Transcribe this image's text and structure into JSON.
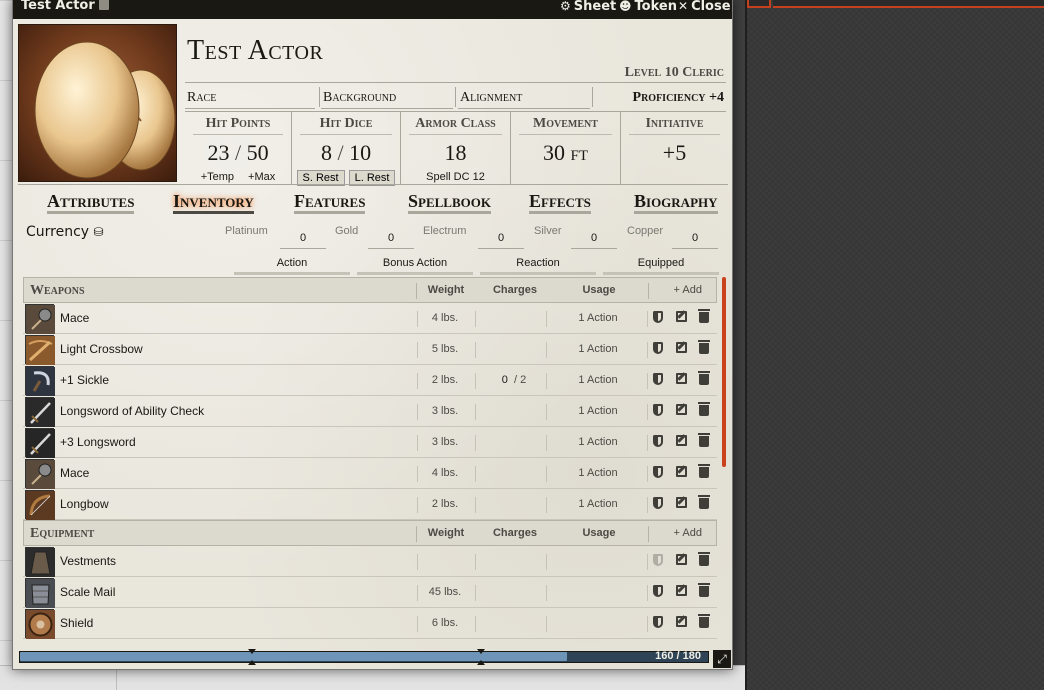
{
  "window": {
    "title": "Test Actor",
    "header_buttons": [
      {
        "icon": "gear-icon",
        "label": "Sheet"
      },
      {
        "icon": "user-circle-icon",
        "label": "Token"
      },
      {
        "icon": "close-icon",
        "label": "Close"
      }
    ]
  },
  "actor": {
    "name": "Test Actor",
    "level_class": "Level 10 Cleric",
    "race": "Race",
    "background": "Background",
    "alignment": "Alignment",
    "proficiency": "Proficiency +4"
  },
  "stats": {
    "hit_points": {
      "label": "Hit Points",
      "value": "23",
      "sep": "/",
      "max": "50",
      "temp_label": "+Temp",
      "max_label": "+Max"
    },
    "hit_dice": {
      "label": "Hit Dice",
      "value": "8",
      "sep": "/",
      "max": "10",
      "short_rest": "S. Rest",
      "long_rest": "L. Rest"
    },
    "armor_class": {
      "label": "Armor Class",
      "value": "18",
      "sub": "Spell DC 12"
    },
    "movement": {
      "label": "Movement",
      "value": "30 ft"
    },
    "initiative": {
      "label": "Initiative",
      "value": "+5"
    }
  },
  "tabs": [
    "Attributes",
    "Inventory",
    "Features",
    "Spellbook",
    "Effects",
    "Biography"
  ],
  "active_tab": "Inventory",
  "currency": {
    "label": "Currency",
    "coins": [
      {
        "label": "Platinum",
        "value": "0"
      },
      {
        "label": "Gold",
        "value": "0"
      },
      {
        "label": "Electrum",
        "value": "0"
      },
      {
        "label": "Silver",
        "value": "0"
      },
      {
        "label": "Copper",
        "value": "0"
      }
    ]
  },
  "action_headers": [
    "Action",
    "Bonus Action",
    "Reaction",
    "Equipped"
  ],
  "columns": {
    "weight": "Weight",
    "charges": "Charges",
    "usage": "Usage",
    "add": "+ Add"
  },
  "weapons": {
    "title": "Weapons",
    "items": [
      {
        "name": "Mace",
        "weight": "4 lbs.",
        "charges": "",
        "charges_max": "",
        "usage": "1 Action",
        "icon": "mace-icon",
        "color": "#5a4a3c"
      },
      {
        "name": "Light Crossbow",
        "weight": "5 lbs.",
        "charges": "",
        "charges_max": "",
        "usage": "1 Action",
        "icon": "crossbow-icon",
        "color": "#8a5a2c"
      },
      {
        "name": "+1 Sickle",
        "weight": "2 lbs.",
        "charges": "0",
        "charges_max": "/ 2",
        "usage": "1 Action",
        "icon": "sickle-icon",
        "color": "#2e3440"
      },
      {
        "name": "Longsword of Ability Check",
        "weight": "3 lbs.",
        "charges": "",
        "charges_max": "",
        "usage": "1 Action",
        "icon": "sword-icon",
        "color": "#2a2a2a"
      },
      {
        "name": "+3 Longsword",
        "weight": "3 lbs.",
        "charges": "",
        "charges_max": "",
        "usage": "1 Action",
        "icon": "sword-icon",
        "color": "#262626"
      },
      {
        "name": "Mace",
        "weight": "4 lbs.",
        "charges": "",
        "charges_max": "",
        "usage": "1 Action",
        "icon": "mace-icon",
        "color": "#5a4a3c"
      },
      {
        "name": "Longbow",
        "weight": "2 lbs.",
        "charges": "",
        "charges_max": "",
        "usage": "1 Action",
        "icon": "bow-icon",
        "color": "#5c3a22"
      }
    ]
  },
  "equipment": {
    "title": "Equipment",
    "items": [
      {
        "name": "Vestments",
        "weight": "",
        "usage": "",
        "icon": "robe-icon",
        "color": "#2c2c2c",
        "faded": true
      },
      {
        "name": "Scale Mail",
        "weight": "45 lbs.",
        "usage": "",
        "icon": "armor-icon",
        "color": "#4a4d52",
        "faded": false
      },
      {
        "name": "Shield",
        "weight": "6 lbs.",
        "usage": "",
        "icon": "shield-icon",
        "color": "#7a4a2c",
        "faded": false
      }
    ]
  },
  "encumbrance": {
    "value": 160,
    "max": 180,
    "text": "160 / 180"
  }
}
